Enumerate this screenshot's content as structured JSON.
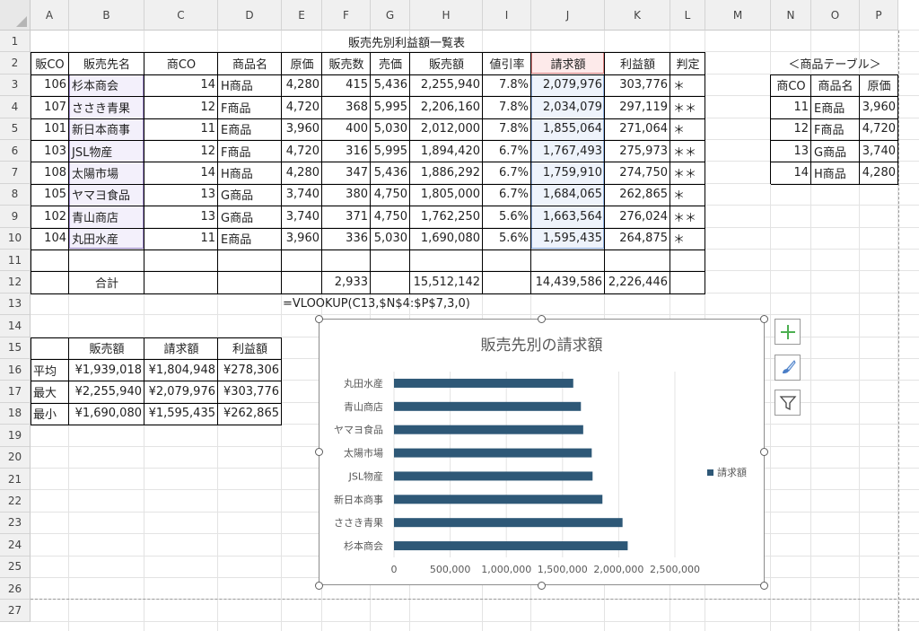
{
  "columns": [
    "A",
    "B",
    "C",
    "D",
    "E",
    "F",
    "G",
    "H",
    "I",
    "J",
    "K",
    "L",
    "M",
    "N",
    "O",
    "P"
  ],
  "rows": [
    "1",
    "2",
    "3",
    "4",
    "5",
    "6",
    "7",
    "8",
    "9",
    "10",
    "11",
    "12",
    "13",
    "14",
    "15",
    "16",
    "17",
    "18",
    "19",
    "20",
    "21",
    "22",
    "23",
    "24",
    "25",
    "26",
    "27"
  ],
  "title": "販売先別利益額一覧表",
  "headers": [
    "販CO",
    "販売先名",
    "商CO",
    "商品名",
    "原価",
    "販売数",
    "売価",
    "販売額",
    "値引率",
    "請求額",
    "利益額",
    "判定"
  ],
  "data_rows": [
    [
      "106",
      "杉本商会",
      "14",
      "H商品",
      "4,280",
      "415",
      "5,436",
      "2,255,940",
      "7.8%",
      "2,079,976",
      "303,776",
      "＊"
    ],
    [
      "107",
      "ささき青果",
      "12",
      "F商品",
      "4,720",
      "368",
      "5,995",
      "2,206,160",
      "7.8%",
      "2,034,079",
      "297,119",
      "＊＊"
    ],
    [
      "101",
      "新日本商事",
      "11",
      "E商品",
      "3,960",
      "400",
      "5,030",
      "2,012,000",
      "7.8%",
      "1,855,064",
      "271,064",
      "＊"
    ],
    [
      "103",
      "JSL物産",
      "12",
      "F商品",
      "4,720",
      "316",
      "5,995",
      "1,894,420",
      "6.7%",
      "1,767,493",
      "275,973",
      "＊＊"
    ],
    [
      "108",
      "太陽市場",
      "14",
      "H商品",
      "4,280",
      "347",
      "5,436",
      "1,886,292",
      "6.7%",
      "1,759,910",
      "274,750",
      "＊＊"
    ],
    [
      "105",
      "ヤマヨ食品",
      "13",
      "G商品",
      "3,740",
      "380",
      "4,750",
      "1,805,000",
      "6.7%",
      "1,684,065",
      "262,865",
      "＊"
    ],
    [
      "102",
      "青山商店",
      "13",
      "G商品",
      "3,740",
      "371",
      "4,750",
      "1,762,250",
      "5.6%",
      "1,663,564",
      "276,024",
      "＊＊"
    ],
    [
      "104",
      "丸田水産",
      "11",
      "E商品",
      "3,960",
      "336",
      "5,030",
      "1,690,080",
      "5.6%",
      "1,595,435",
      "264,875",
      "＊"
    ]
  ],
  "total": {
    "label": "合計",
    "count": "2,933",
    "sales": "15,512,142",
    "billed": "14,439,586",
    "profit": "2,226,446"
  },
  "formula_text": "=VLOOKUP(C13,$N$4:$P$7,3,0)",
  "stats": {
    "headers": [
      "販売額",
      "請求額",
      "利益額"
    ],
    "rows": [
      {
        "label": "平均",
        "values": [
          "¥1,939,018",
          "¥1,804,948",
          "¥278,306"
        ]
      },
      {
        "label": "最大",
        "values": [
          "¥2,255,940",
          "¥2,079,976",
          "¥303,776"
        ]
      },
      {
        "label": "最小",
        "values": [
          "¥1,690,080",
          "¥1,595,435",
          "¥262,865"
        ]
      }
    ]
  },
  "product_table": {
    "title": "＜商品テーブル＞",
    "headers": [
      "商CO",
      "商品名",
      "原価"
    ],
    "rows": [
      [
        "11",
        "E商品",
        "3,960"
      ],
      [
        "12",
        "F商品",
        "4,720"
      ],
      [
        "13",
        "G商品",
        "3,740"
      ],
      [
        "14",
        "H商品",
        "4,280"
      ]
    ]
  },
  "colors": {
    "bar": "#2e5877",
    "highlight_fill": "#f3f0fb",
    "highlight_border": "#9b87c8",
    "billed_fill": "#eef3fb",
    "billed_border": "#8fb0e0",
    "billed_header_fill": "#fdeaea",
    "billed_header_border": "#e08484",
    "accent_green": "#4caf50",
    "accent_blue": "#4a7ec7"
  },
  "chart_buttons": [
    "plus-icon",
    "brush-icon",
    "filter-icon"
  ],
  "chart_data": {
    "type": "bar",
    "orientation": "horizontal",
    "title": "販売先別の請求額",
    "categories": [
      "丸田水産",
      "青山商店",
      "ヤマヨ食品",
      "太陽市場",
      "JSL物産",
      "新日本商事",
      "ささき青果",
      "杉本商会"
    ],
    "series": [
      {
        "name": "請求額",
        "values": [
          1595435,
          1663564,
          1684065,
          1759910,
          1767493,
          1855064,
          2034079,
          2079976
        ]
      }
    ],
    "xlim": [
      0,
      2500000
    ],
    "x_ticks": [
      "0",
      "500,000",
      "1,000,000",
      "1,500,000",
      "2,000,000",
      "2,500,000"
    ],
    "grid": true,
    "legend": "right"
  }
}
